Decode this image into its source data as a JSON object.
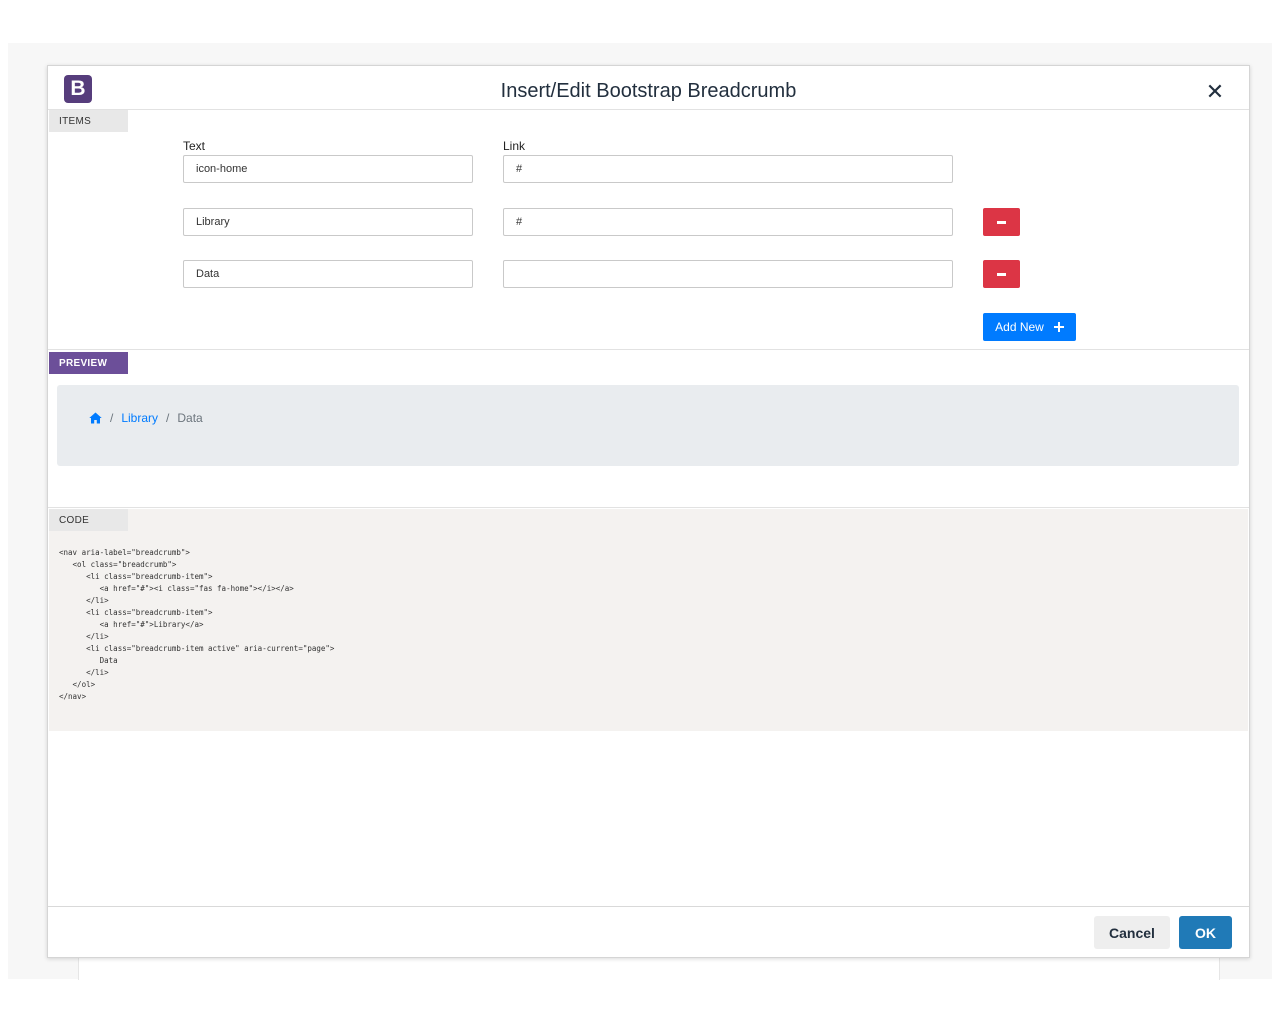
{
  "dialog": {
    "logo_letter": "B",
    "title": "Insert/Edit Bootstrap Breadcrumb",
    "close_symbol": "✕"
  },
  "items_section": {
    "tab_label": "ITEMS",
    "text_label": "Text",
    "link_label": "Link",
    "rows": [
      {
        "text": "icon-home",
        "link": "#"
      },
      {
        "text": "Library",
        "link": "#"
      },
      {
        "text": "Data",
        "link": ""
      }
    ],
    "add_new_label": "Add New"
  },
  "preview_section": {
    "tab_label": "PREVIEW",
    "separator": "/",
    "home_icon": "home-icon",
    "crumb_library": "Library",
    "crumb_data": "Data"
  },
  "code_section": {
    "tab_label": "CODE",
    "lines": {
      "l1": "<nav aria-label=\"breadcrumb\">",
      "l2": "<ol class=\"breadcrumb\">",
      "l3": "<li class=\"breadcrumb-item\">",
      "l4": "<a href=\"#\"><i class=\"fas fa-home\"></i></a>",
      "l5": "</li>",
      "l6": "<li class=\"breadcrumb-item\">",
      "l7": "<a href=\"#\">Library</a>",
      "l8": "</li>",
      "l9": "<li class=\"breadcrumb-item active\" aria-current=\"page\">",
      "l10": "Data",
      "l11": "</li>",
      "l12": "</ol>",
      "l13": "</nav>"
    }
  },
  "footer": {
    "cancel_label": "Cancel",
    "ok_label": "OK"
  },
  "colors": {
    "brand": "#563d7c",
    "danger": "#dc3545",
    "primary": "#007bff",
    "ok": "#207ab7",
    "preview_bg": "#e9ecef",
    "code_bg": "#f4f2f0"
  }
}
